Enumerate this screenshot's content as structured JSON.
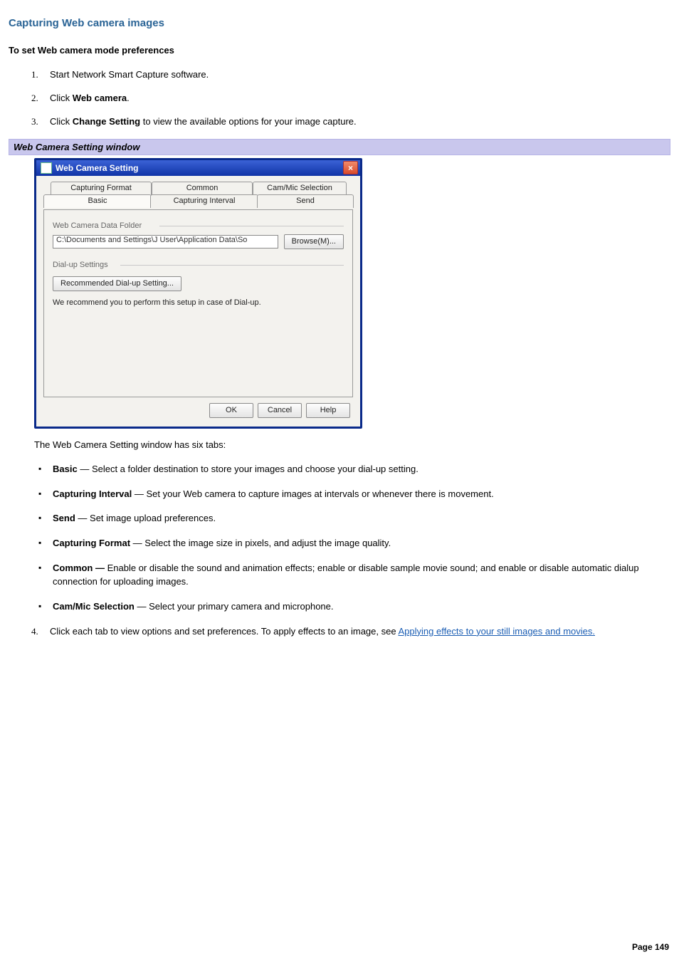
{
  "title": "Capturing Web camera images",
  "subheading": "To set Web camera mode preferences",
  "steps": {
    "s1": "Start Network Smart Capture software.",
    "s2_pre": "Click ",
    "s2_bold": "Web camera",
    "s2_post": ".",
    "s3_pre": "Click ",
    "s3_bold": "Change Setting",
    "s3_post": " to view the available options for your image capture.",
    "s4_pre": "Click each tab to view options and set preferences. To apply effects to an image, see ",
    "s4_link": "Applying effects to your still images and movies."
  },
  "caption": "Web Camera Setting window",
  "dialog": {
    "title": "Web Camera Setting",
    "tabs_back": [
      "Capturing Format",
      "Common",
      "Cam/Mic Selection"
    ],
    "tabs_front": [
      "Basic",
      "Capturing Interval",
      "Send"
    ],
    "group_folder": "Web Camera Data Folder",
    "path_value": "C:\\Documents and Settings\\J User\\Application Data\\So",
    "browse": "Browse(M)...",
    "group_dial": "Dial-up Settings",
    "dial_button": "Recommended Dial-up Setting...",
    "dial_note": "We recommend you to perform this setup in case of Dial-up.",
    "ok": "OK",
    "cancel": "Cancel",
    "help": "Help"
  },
  "tabs_intro": "The Web Camera Setting window has six tabs:",
  "tab_items": {
    "basic": {
      "name": "Basic",
      "sep": " — ",
      "desc": "Select a folder destination to store your images and choose your dial-up setting."
    },
    "interval": {
      "name": "Capturing Interval",
      "sep": " — ",
      "desc": "Set your Web camera to capture images at intervals or whenever there is movement."
    },
    "send": {
      "name": "Send",
      "sep": " — ",
      "desc": "Set image upload preferences."
    },
    "format": {
      "name": "Capturing Format",
      "sep": " — ",
      "desc": "Select the image size in pixels, and adjust the image quality."
    },
    "common": {
      "name": "Common —",
      "sep": " ",
      "desc": "Enable or disable the sound and animation effects; enable or disable sample movie sound; and enable or disable automatic dialup connection for uploading images."
    },
    "cammic": {
      "name": "Cam/Mic Selection",
      "sep": " — ",
      "desc": "Select your primary camera and microphone."
    }
  },
  "page_num": "Page 149"
}
